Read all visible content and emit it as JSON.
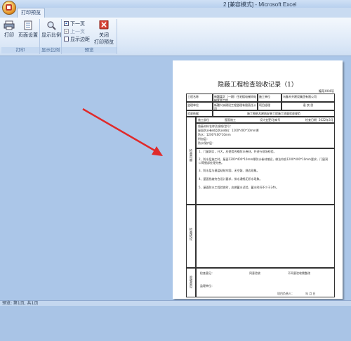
{
  "window": {
    "title": "2 [兼容模式] - Microsoft Excel"
  },
  "tab": {
    "label": "打印预览"
  },
  "ribbon": {
    "groups": [
      {
        "label": "打印"
      },
      {
        "label": "显示比例"
      },
      {
        "label": "预览"
      }
    ],
    "print": {
      "label": "打印"
    },
    "page_setup": {
      "label": "页面设置"
    },
    "zoom": {
      "label": "显示比例"
    },
    "next_page": {
      "label": "下一页"
    },
    "prev_page": {
      "label": "上一页"
    },
    "show_margins": {
      "label": "显示边距"
    },
    "close": {
      "label1": "关闭",
      "label2": "打印预览"
    }
  },
  "document": {
    "title": "隐蔽工程检查验收记录（1）",
    "number": "编号004号",
    "rows": {
      "project_name_label": "工程名称",
      "project_name_value": "新疆某区（一期）住宅楼电梯间电梯套管工程",
      "construction_label": "施工单位",
      "construction_value": "乌鲁木齐建设集团有限公司",
      "supervisor_label": "监理单位",
      "supervisor_value": "新疆兴洲建设工程监理有限责任公司",
      "project_manager_label": "项目经理",
      "project_manager_value": "袁 良 思",
      "basis_label": "验收依据",
      "basis_value": "施工图纸及建筑安装工程施工质量验收规范",
      "part_label": "施工部位",
      "part_value": "屋面施工",
      "design_label": "设计变更/洽商号",
      "check_date_label": "检查日期",
      "check_date_value": "2022年3月"
    },
    "left_labels": {
      "check_content": "检查内容",
      "check_result": "检查结论",
      "acceptance": "验收意见"
    },
    "content_lines": [
      "隐蔽材料名称及规格/型号：",
      "屋面防水卷材及防水材料：1200*400*10mm厚",
      "防水：1200*400*10mm",
      "附加层：",
      "防水保护层："
    ],
    "result_lines": [
      "1、门窗洞口，开大，应使用合格防水卷材，并进行现场检验。",
      "2、防水层施工时，屋面1200*400*10mm厚防水卷材铺设，做法符合1200*400*10mm要求，门窗洞口等细部处理完善。",
      "3、防水层与基层粘结牢固，无空鼓、翘边现象。",
      "4、屋面找坡符合设计要求，排水通畅无积水现象。",
      "5、屋面防水工程验收时，应做蓄水试验，蓄水时间不少于24h。"
    ],
    "footer": {
      "conclusion_label": "检查意见：",
      "agree_label": "同意验收",
      "signature_label": "项目负责人：",
      "date_label": "年 月 日",
      "acceptance_label": "监理单位：",
      "not_agree_label": "不同意验收需整改"
    }
  },
  "statusbar": {
    "text": "预览: 第1页, 共1页"
  },
  "colors": {
    "arrow": "#e02a2a",
    "ribbon_bg": "#dce8f7",
    "workspace": "#abc6e8"
  }
}
